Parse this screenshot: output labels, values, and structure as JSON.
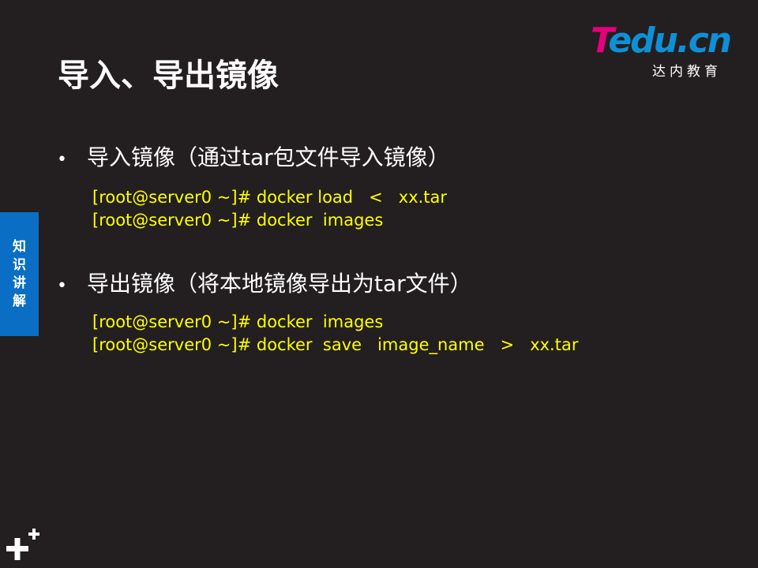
{
  "logo": {
    "word_t": "T",
    "word_rest": "edu.cn",
    "subtitle": "达内教育"
  },
  "title": "导入、导出镜像",
  "side_tab": {
    "chars": [
      "知",
      "识",
      "讲",
      "解"
    ]
  },
  "sections": [
    {
      "heading": "导入镜像（通过tar包文件导入镜像）",
      "commands": [
        "[root@server0 ~]# docker load   <   xx.tar",
        "[root@server0 ~]# docker  images"
      ]
    },
    {
      "heading": "导出镜像（将本地镜像导出为tar文件）",
      "commands": [
        "[root@server0 ~]# docker  images",
        "[root@server0 ~]# docker  save   image_name   >   xx.tar"
      ]
    }
  ],
  "bullet_glyph": "•",
  "colors": {
    "background": "#231f20",
    "code": "#ffff00",
    "side_tab": "#0a6ec4",
    "logo_pink": "#e6007e",
    "logo_blue": "#0f8fd6"
  }
}
